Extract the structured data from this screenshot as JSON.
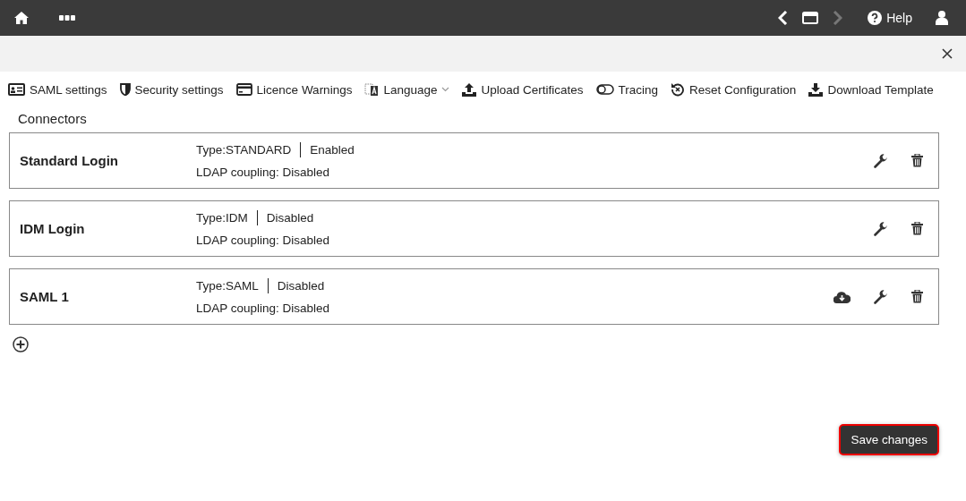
{
  "topbar": {
    "help": "Help"
  },
  "toolbar": [
    {
      "kind": "saml",
      "label": "SAML settings"
    },
    {
      "kind": "security",
      "label": "Security settings"
    },
    {
      "kind": "licence",
      "label": "Licence Warnings"
    },
    {
      "kind": "language",
      "label": "Language",
      "dropdown": true
    },
    {
      "kind": "upload",
      "label": "Upload Certificates"
    },
    {
      "kind": "tracing",
      "label": "Tracing"
    },
    {
      "kind": "reset",
      "label": "Reset Configuration"
    },
    {
      "kind": "download",
      "label": "Download Template"
    }
  ],
  "section_title": "Connectors",
  "connectors": [
    {
      "name": "Standard Login",
      "type": "Type:STANDARD",
      "status": "Enabled",
      "ldap": "LDAP coupling: Disabled",
      "cloud_download": false
    },
    {
      "name": "IDM Login",
      "type": "Type:IDM",
      "status": "Disabled",
      "ldap": "LDAP coupling: Disabled",
      "cloud_download": false
    },
    {
      "name": "SAML 1",
      "type": "Type:SAML",
      "status": "Disabled",
      "ldap": "LDAP coupling: Disabled",
      "cloud_download": true
    }
  ],
  "save_button": "Save changes"
}
